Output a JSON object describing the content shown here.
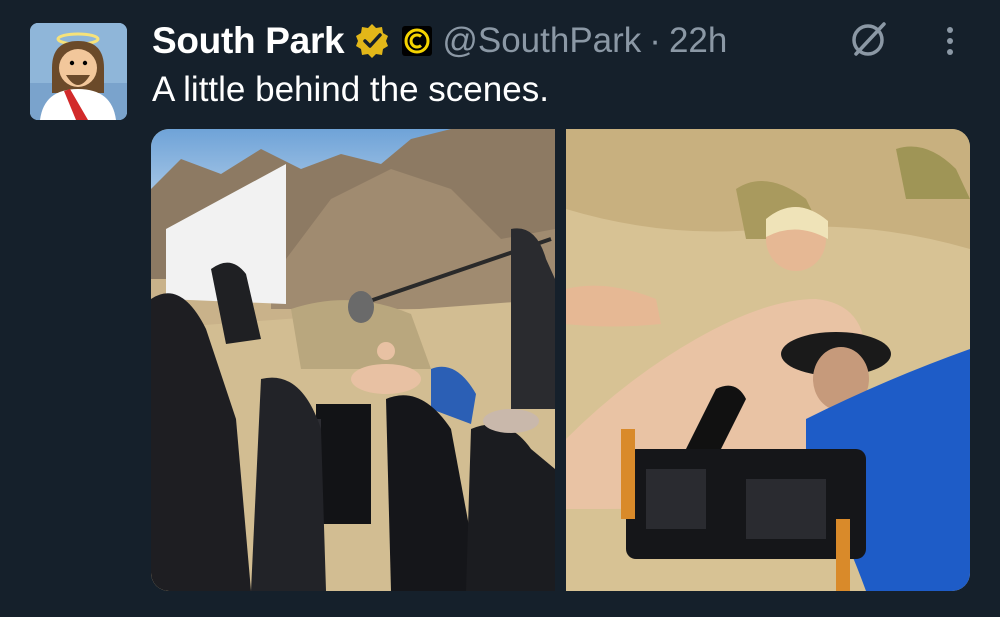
{
  "tweet": {
    "display_name": "South Park",
    "handle": "@SouthPark",
    "separator": "·",
    "time": "22h",
    "text": "A little behind the scenes."
  },
  "icons": {
    "verified": "verified-gold-badge-icon",
    "affiliate": "comedy-central-logo-icon",
    "grok": "grok-icon",
    "more": "more-vertical-icon"
  },
  "colors": {
    "background": "#15202b",
    "text_primary": "#ffffff",
    "text_secondary": "#8b98a5",
    "verified_gold": "#e2b719"
  },
  "media": {
    "count": 2
  }
}
